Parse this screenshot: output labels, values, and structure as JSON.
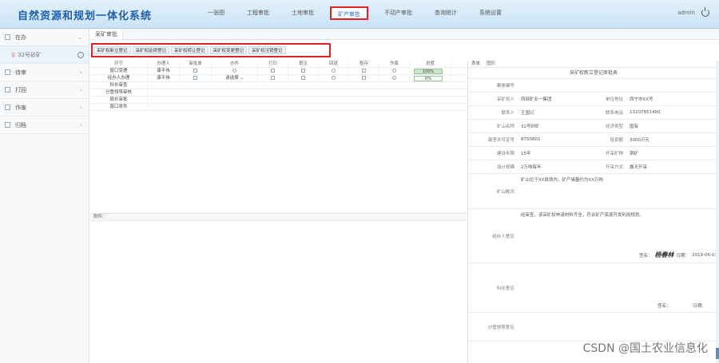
{
  "header": {
    "title": "自然资源和规划一体化系统",
    "nav": [
      "一张图",
      "工程审批",
      "土地审批",
      "矿产审批",
      "不动产审批",
      "查询统计",
      "系统设置"
    ],
    "active_nav": "矿产审批",
    "user": "admin"
  },
  "sidebar": {
    "items": [
      {
        "label": "在办",
        "type": "folder"
      },
      {
        "label": "32号砂矿",
        "type": "sub"
      },
      {
        "label": "待审",
        "type": "folder"
      },
      {
        "label": "打回",
        "type": "folder"
      },
      {
        "label": "作废",
        "type": "folder"
      },
      {
        "label": "归档",
        "type": "folder"
      }
    ]
  },
  "main": {
    "tab": "采矿审批",
    "subtabs": [
      "采矿权新立登记",
      "采矿权延续登记",
      "采矿权转让登记",
      "采矿权变更登记",
      "采矿权注销登记"
    ],
    "workflow_columns": [
      "环节",
      "办理人",
      "审批单",
      "办件",
      "打印",
      "意见",
      "回退",
      "暂存",
      "作废",
      "进度"
    ],
    "workflow_rows": [
      {
        "step": "窗口受理",
        "handler": "康平伟",
        "action": "",
        "progress": 1,
        "progress_text": "100%"
      },
      {
        "step": "经办人办理",
        "handler": "康平伟",
        "action": "请选择",
        "progress": 0,
        "progress_text": "0%"
      },
      {
        "step": "科长审查",
        "handler": "",
        "action": "",
        "progress": null,
        "progress_text": ""
      },
      {
        "step": "分管领导审核",
        "handler": "",
        "action": "",
        "progress": null,
        "progress_text": ""
      },
      {
        "step": "局长审批",
        "handler": "",
        "action": "",
        "progress": null,
        "progress_text": ""
      },
      {
        "step": "窗口发件",
        "handler": "",
        "action": "",
        "progress": null,
        "progress_text": ""
      }
    ],
    "attachment_label": "附件："
  },
  "form": {
    "tabs": [
      "表单",
      "图形"
    ],
    "title": "采矿权新立登记审批表",
    "rows": [
      {
        "label": "案卷编号",
        "value": ""
      },
      {
        "label": "采矿权人",
        "value": "西部矿业一集团",
        "label2": "单位地址",
        "value2": "西宁市XX号"
      },
      {
        "label": "联系人",
        "value": "王国兴",
        "label2": "联系电话",
        "value2": "13207851480"
      },
      {
        "label": "矿山名称",
        "value": "32号砂矿",
        "label2": "经济类型",
        "value2": "国有"
      },
      {
        "label": "勘查许可证号",
        "value": "8750801",
        "label2": "投资额",
        "value2": "3000万元"
      },
      {
        "label": "建设年限",
        "value": "15年",
        "label2": "开采矿种",
        "value2": "铜矿"
      },
      {
        "label": "设计规模",
        "value": "2万吨每年",
        "label2": "开采方式",
        "value2": "露天开采"
      },
      {
        "label": "矿山概况",
        "value": "矿山位于XX县境内，矿产储量约为XX万吨"
      }
    ],
    "opinions": [
      {
        "label": "经办人意见",
        "text": "经审查，该采矿权申请材料齐全，符合矿产资源开发利用规划。",
        "sign_label": "签名：",
        "signature": "杨春林",
        "date_label": "日期：",
        "date": "2019-06-01"
      },
      {
        "label": "科长意见",
        "text": "",
        "sign_label": "签名：",
        "signature": "",
        "date_label": "日期：",
        "date": ""
      },
      {
        "label": "分管领导意见",
        "text": "",
        "sign_label": "",
        "signature": "",
        "date_label": "",
        "date": ""
      }
    ]
  },
  "watermark": "CSDN @国土农业信息化",
  "colors": {
    "header_bg": "#c9e3f6",
    "title": "#1f5fa8",
    "highlight": "#e12222",
    "progress_fill": "#c8e6c8"
  }
}
